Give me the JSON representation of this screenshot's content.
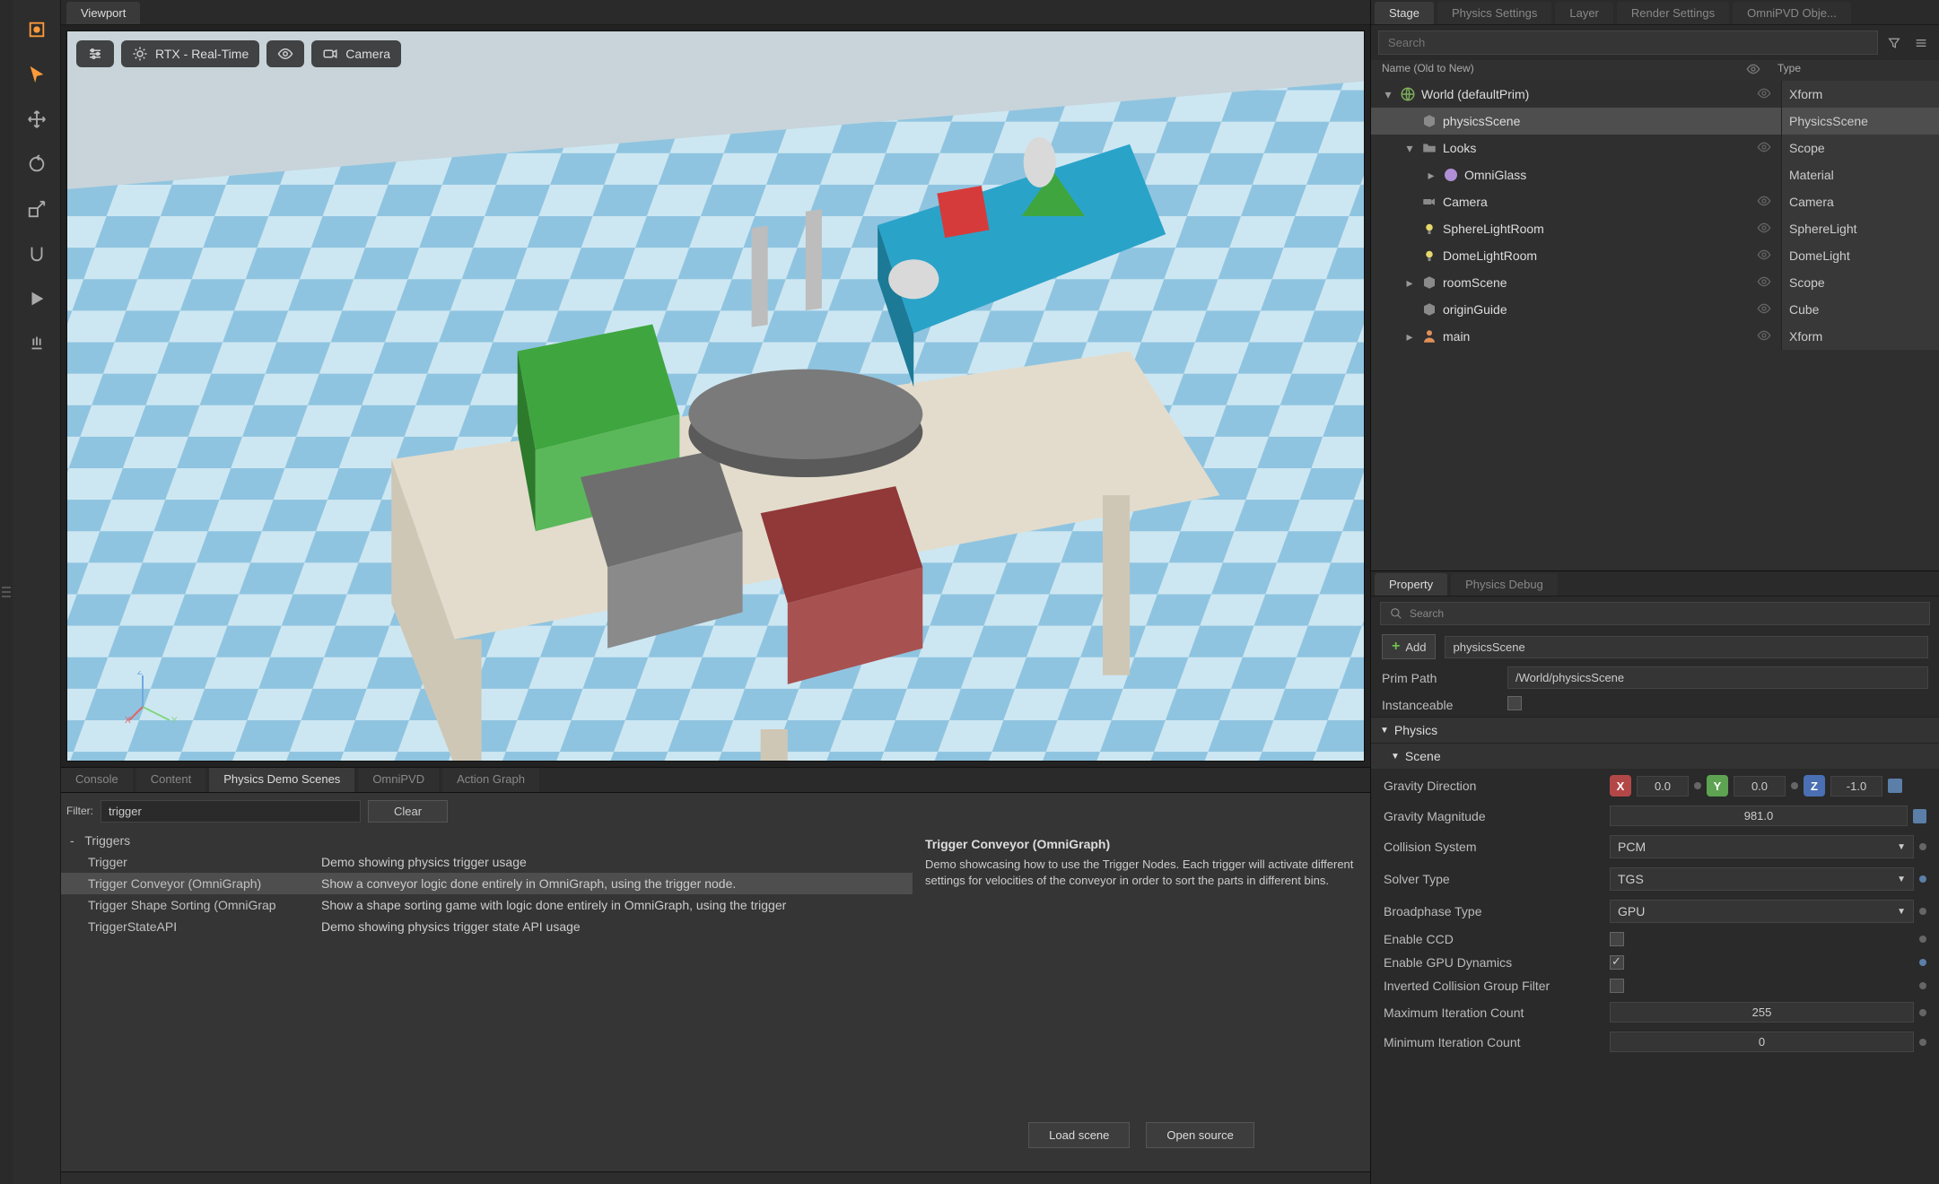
{
  "viewport": {
    "tab": "Viewport",
    "render_mode": "RTX - Real-Time",
    "camera_btn": "Camera"
  },
  "left_tools": [
    "frame",
    "select",
    "move",
    "rotate",
    "scale",
    "snap",
    "play",
    "physics"
  ],
  "bottom_tabs": {
    "items": [
      "Console",
      "Content",
      "Physics Demo Scenes",
      "OmniPVD",
      "Action Graph"
    ],
    "active": 2
  },
  "demo": {
    "filter_label": "Filter:",
    "filter_value": "trigger",
    "clear": "Clear",
    "group": "Triggers",
    "rows": [
      {
        "name": "Trigger",
        "desc": "Demo showing physics trigger usage"
      },
      {
        "name": "Trigger Conveyor (OmniGraph)",
        "desc": "Show a conveyor logic done entirely in OmniGraph, using the trigger node."
      },
      {
        "name": "Trigger Shape Sorting (OmniGrap",
        "desc": "Show a shape sorting game with logic done entirely in OmniGraph, using the trigger"
      },
      {
        "name": "TriggerStateAPI",
        "desc": "Demo showing physics trigger state API usage"
      }
    ],
    "selected": 1,
    "detail_title": "Trigger Conveyor (OmniGraph)",
    "detail_text": "Demo showcasing how to use the Trigger Nodes. Each trigger will activate different settings for velocities of the conveyor in order to sort the parts in different bins.",
    "load_btn": "Load scene",
    "open_btn": "Open source"
  },
  "stage": {
    "tabs": [
      "Stage",
      "Physics Settings",
      "Layer",
      "Render Settings",
      "OmniPVD Obje..."
    ],
    "search_ph": "Search",
    "header_name": "Name (Old to New)",
    "header_type": "Type",
    "rows": [
      {
        "depth": 0,
        "exp": "-",
        "icon": "world",
        "name": "World (defaultPrim)",
        "type": "Xform",
        "vis": true
      },
      {
        "depth": 1,
        "exp": "",
        "icon": "cube",
        "name": "physicsScene",
        "type": "PhysicsScene",
        "vis": false,
        "selected": true
      },
      {
        "depth": 1,
        "exp": "-",
        "icon": "folder",
        "name": "Looks",
        "type": "Scope",
        "vis": true
      },
      {
        "depth": 2,
        "exp": "+",
        "icon": "mat",
        "name": "OmniGlass",
        "type": "Material",
        "vis": false
      },
      {
        "depth": 1,
        "exp": "",
        "icon": "cam",
        "name": "Camera",
        "type": "Camera",
        "vis": true
      },
      {
        "depth": 1,
        "exp": "",
        "icon": "light",
        "name": "SphereLightRoom",
        "type": "SphereLight",
        "vis": true
      },
      {
        "depth": 1,
        "exp": "",
        "icon": "light",
        "name": "DomeLightRoom",
        "type": "DomeLight",
        "vis": true
      },
      {
        "depth": 1,
        "exp": "+",
        "icon": "cube",
        "name": "roomScene",
        "type": "Scope",
        "vis": true
      },
      {
        "depth": 1,
        "exp": "",
        "icon": "cube",
        "name": "originGuide",
        "type": "Cube",
        "vis": true
      },
      {
        "depth": 1,
        "exp": "+",
        "icon": "person",
        "name": "main",
        "type": "Xform",
        "vis": true
      }
    ]
  },
  "property": {
    "tabs": [
      "Property",
      "Physics Debug"
    ],
    "search_ph": "Search",
    "add": "Add",
    "name_value": "physicsScene",
    "path_label": "Prim Path",
    "path_value": "/World/physicsScene",
    "inst_label": "Instanceable",
    "sec_physics": "Physics",
    "sec_scene": "Scene",
    "gravity_dir": {
      "label": "Gravity Direction",
      "x": "0.0",
      "y": "0.0",
      "z": "-1.0"
    },
    "gravity_mag": {
      "label": "Gravity Magnitude",
      "value": "981.0"
    },
    "collision": {
      "label": "Collision System",
      "value": "PCM"
    },
    "solver": {
      "label": "Solver Type",
      "value": "TGS"
    },
    "broadphase": {
      "label": "Broadphase Type",
      "value": "GPU"
    },
    "ccd": {
      "label": "Enable CCD",
      "checked": false
    },
    "gpu_dyn": {
      "label": "Enable GPU Dynamics",
      "checked": true
    },
    "inv_coll": {
      "label": "Inverted Collision Group Filter",
      "checked": false
    },
    "max_iter": {
      "label": "Maximum Iteration Count",
      "value": "255"
    },
    "min_iter": {
      "label": "Minimum Iteration Count",
      "value": "0"
    }
  }
}
